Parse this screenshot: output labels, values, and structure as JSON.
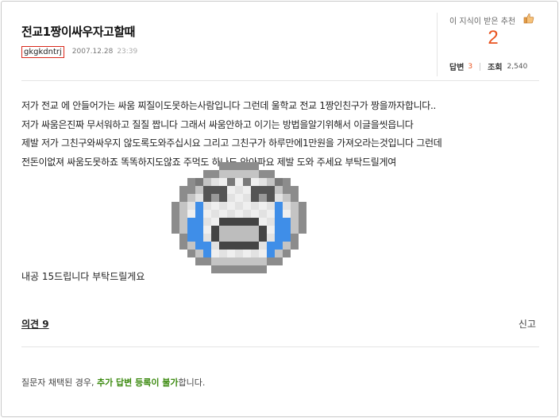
{
  "question": {
    "title": "전교1짱이싸우자고할때",
    "author": "gkgkdntrj",
    "date": "2007.12.28",
    "time": "23:39",
    "body_lines": [
      "저가 전교 에 안들어가는 싸움 찌질이도못하는사람입니다 그런데 울학교 전교 1짱인친구가 짱을까자합니다..",
      "저가 싸움은진짜 무서워하고 질질 짭니다 그래서 싸움안하고 이기는 방법을알기위해서 이글을씻읍니다",
      "제발 저가 그친구와싸우지 않도록도와주십시요 그리고 그친구가 하루만에1만원을 가져오라는것입니다 그런데",
      "전돈이없져 싸움도못하죠 똑똑하지도않죠 주먹도 하나도 안아파요 제발 도와 주세요 부탁드릴게여"
    ],
    "closing": "내공 15드립니다 부탁드릴게요"
  },
  "recommend": {
    "label": "이 지식이 받은 추천",
    "count": "2",
    "icon": "thumbs-up-icon"
  },
  "stats": {
    "answers_label": "답변",
    "answers_count": "3",
    "views_label": "조회",
    "views_count": "2,540"
  },
  "footer": {
    "opinions_label": "의견 9",
    "report_label": "신고",
    "notice_prefix": "질문자 채택된 경우, ",
    "notice_highlight": "추가 답변 등록이 불가",
    "notice_suffix": "합니다."
  },
  "colors": {
    "accent": "#e9531f",
    "highlight_green": "#3c8a10",
    "author_border": "#d9291c",
    "emoticon_blue": "#3f8ee8"
  }
}
